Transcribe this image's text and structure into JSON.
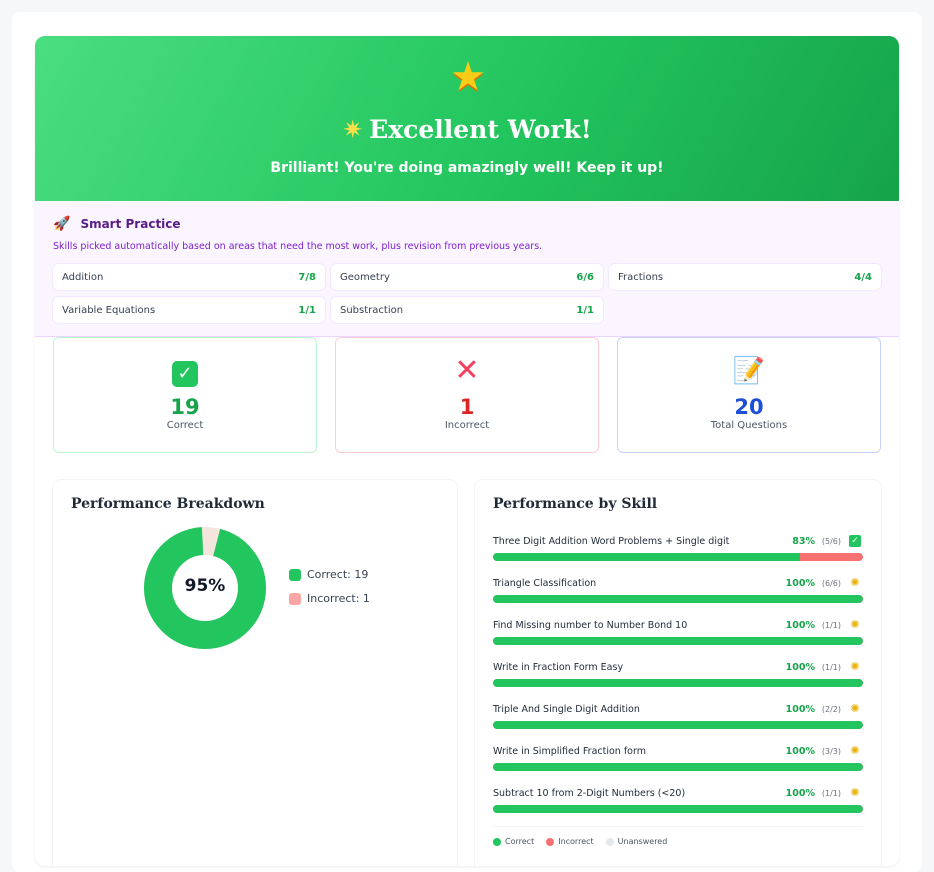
{
  "hero": {
    "title": "Excellent Work!",
    "subtitle": "Brilliant! You're doing amazingly well! Keep it up!"
  },
  "smart_practice": {
    "title": "Smart Practice",
    "description": "Skills picked automatically based on areas that need the most work, plus revision from previous years.",
    "chips": [
      {
        "label": "Addition",
        "score": "7/8"
      },
      {
        "label": "Geometry",
        "score": "6/6"
      },
      {
        "label": "Fractions",
        "score": "4/4"
      },
      {
        "label": "Variable Equations",
        "score": "1/1"
      },
      {
        "label": "Substraction",
        "score": "1/1"
      }
    ]
  },
  "stats": {
    "correct": {
      "value": "19",
      "label": "Correct"
    },
    "incorrect": {
      "value": "1",
      "label": "Incorrect"
    },
    "total": {
      "value": "20",
      "label": "Total Questions"
    }
  },
  "breakdown": {
    "title": "Performance Breakdown",
    "percent_label": "95%",
    "correct_fraction": 0.95,
    "legend_correct": "Correct: 19",
    "legend_incorrect": "Incorrect: 1",
    "color_correct": "#22c55e",
    "color_incorrect": "#fca5a5"
  },
  "skills": {
    "title": "Performance by Skill",
    "items": [
      {
        "name": "Three Digit Addition Word Problems + Single digit",
        "pct": "83%",
        "frac": "(5/6)",
        "fill": 0.83,
        "icon": "check-icon"
      },
      {
        "name": "Triangle Classification",
        "pct": "100%",
        "frac": "(6/6)",
        "fill": 1.0,
        "icon": "sparkle-icon"
      },
      {
        "name": "Find Missing number to Number Bond 10",
        "pct": "100%",
        "frac": "(1/1)",
        "fill": 1.0,
        "icon": "sparkle-icon"
      },
      {
        "name": "Write in Fraction Form Easy",
        "pct": "100%",
        "frac": "(1/1)",
        "fill": 1.0,
        "icon": "sparkle-icon"
      },
      {
        "name": "Triple And Single Digit Addition",
        "pct": "100%",
        "frac": "(2/2)",
        "fill": 1.0,
        "icon": "sparkle-icon"
      },
      {
        "name": "Write in Simplified Fraction form",
        "pct": "100%",
        "frac": "(3/3)",
        "fill": 1.0,
        "icon": "sparkle-icon"
      },
      {
        "name": "Subtract 10 from 2-Digit Numbers (<20)",
        "pct": "100%",
        "frac": "(1/1)",
        "fill": 1.0,
        "icon": "sparkle-icon"
      }
    ],
    "legend": {
      "correct": "Correct",
      "incorrect": "Incorrect",
      "unanswered": "Unanswered"
    },
    "colors": {
      "correct": "#22c55e",
      "incorrect": "#f87171",
      "unanswered": "#e5e7eb"
    }
  },
  "colors": {
    "correct_text": "#16a34a",
    "incorrect_text": "#dc2626",
    "total_text": "#1d4ed8",
    "hero_green": "#22c55e"
  }
}
